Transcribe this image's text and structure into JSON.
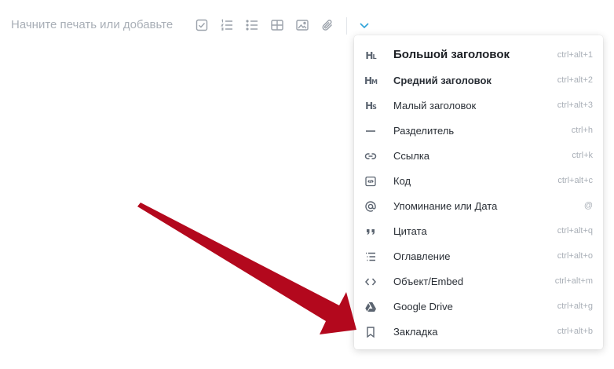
{
  "editor": {
    "placeholder": "Начните печать или добавьте"
  },
  "toolbar": {
    "icons": [
      "checkbox-icon",
      "numbered-list-icon",
      "bullet-list-icon",
      "table-icon",
      "image-icon",
      "attachment-icon",
      "chevron-down-icon"
    ],
    "accent_color": "#2ea3d9"
  },
  "menu": {
    "items": [
      {
        "label": "Большой заголовок",
        "shortcut": "ctrl+alt+1",
        "icon": "heading-large-icon"
      },
      {
        "label": "Средний заголовок",
        "shortcut": "ctrl+alt+2",
        "icon": "heading-medium-icon"
      },
      {
        "label": "Малый заголовок",
        "shortcut": "ctrl+alt+3",
        "icon": "heading-small-icon"
      },
      {
        "label": "Разделитель",
        "shortcut": "ctrl+h",
        "icon": "divider-icon"
      },
      {
        "label": "Ссылка",
        "shortcut": "ctrl+k",
        "icon": "link-icon"
      },
      {
        "label": "Код",
        "shortcut": "ctrl+alt+c",
        "icon": "code-block-icon"
      },
      {
        "label": "Упоминание или Дата",
        "shortcut": "@",
        "icon": "at-sign-icon"
      },
      {
        "label": "Цитата",
        "shortcut": "ctrl+alt+q",
        "icon": "quote-icon"
      },
      {
        "label": "Оглавление",
        "shortcut": "ctrl+alt+o",
        "icon": "table-of-contents-icon"
      },
      {
        "label": "Объект/Embed",
        "shortcut": "ctrl+alt+m",
        "icon": "embed-icon"
      },
      {
        "label": "Google Drive",
        "shortcut": "ctrl+alt+g",
        "icon": "google-drive-icon"
      },
      {
        "label": "Закладка",
        "shortcut": "ctrl+alt+b",
        "icon": "bookmark-icon"
      }
    ]
  },
  "annotation": {
    "arrow_color": "#b3081d",
    "points_to": "Закладка"
  }
}
